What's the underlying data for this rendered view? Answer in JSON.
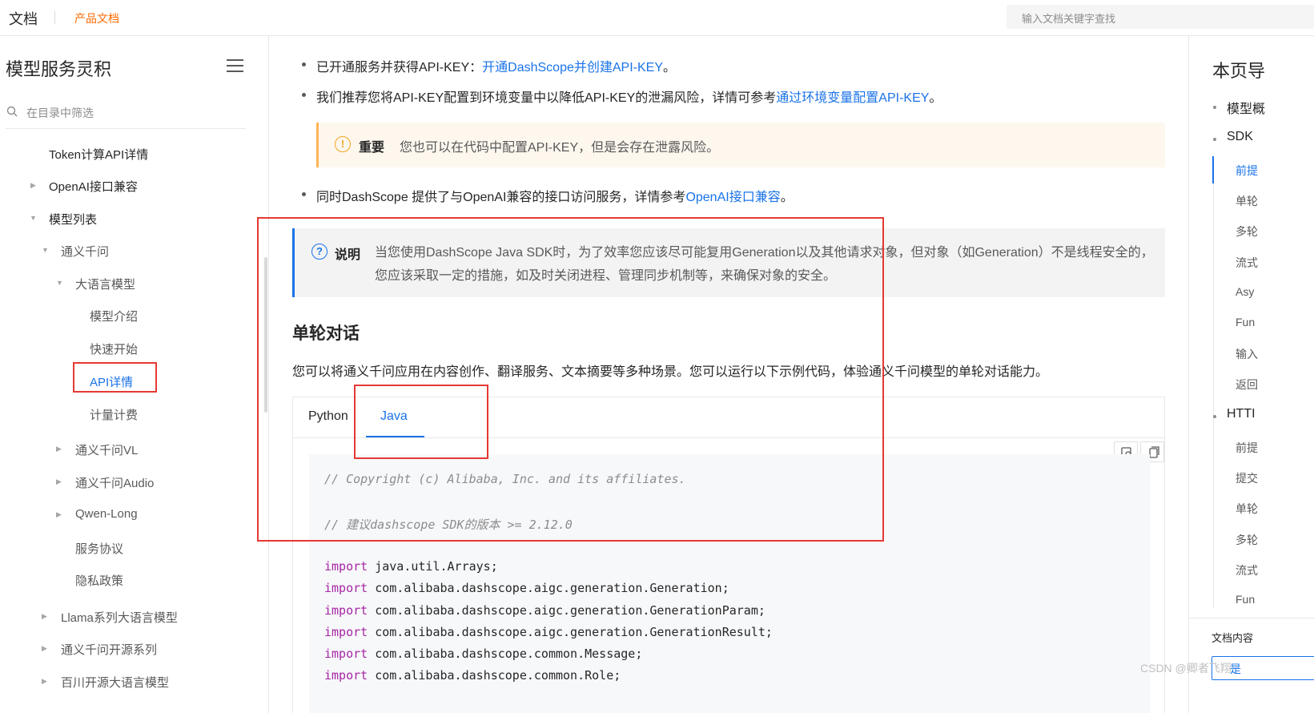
{
  "topbar": {
    "brand": "文档",
    "link": "产品文档",
    "search_placeholder": "输入文档关键字查找"
  },
  "sidebar": {
    "title": "模型服务灵积",
    "filter_placeholder": "在目录中筛选",
    "items": [
      {
        "label": "Token计算API详情"
      },
      {
        "label": "OpenAI接口兼容"
      },
      {
        "label": "模型列表"
      },
      {
        "label": "通义千问"
      },
      {
        "label": "大语言模型"
      },
      {
        "label": "模型介绍"
      },
      {
        "label": "快速开始"
      },
      {
        "label": "API详情"
      },
      {
        "label": "计量计费"
      },
      {
        "label": "通义千问VL"
      },
      {
        "label": "通义千问Audio"
      },
      {
        "label": "Qwen-Long"
      },
      {
        "label": "服务协议"
      },
      {
        "label": "隐私政策"
      },
      {
        "label": "Llama系列大语言模型"
      },
      {
        "label": "通义千问开源系列"
      },
      {
        "label": "百川开源大语言模型"
      }
    ]
  },
  "main": {
    "bullet1_text": "已开通服务并获得API-KEY：",
    "bullet1_link": "开通DashScope并创建API-KEY",
    "bullet1_end": "。",
    "bullet2_text": "我们推荐您将API-KEY配置到环境变量中以降低API-KEY的泄漏风险，详情可参考",
    "bullet2_link": "通过环境变量配置API-KEY",
    "bullet2_end": "。",
    "warning": {
      "icon": "!",
      "title": "重要",
      "text": "您也可以在代码中配置API-KEY，但是会存在泄露风险。"
    },
    "bullet3_text": "同时DashScope 提供了与OpenAI兼容的接口访问服务，详情参考",
    "bullet3_link": "OpenAI接口兼容",
    "bullet3_end": "。",
    "note": {
      "icon": "?",
      "title": "说明",
      "text": "当您使用DashScope Java SDK时，为了效率您应该尽可能复用Generation以及其他请求对象，但对象（如Generation）不是线程安全的，您应该采取一定的措施，如及时关闭进程、管理同步机制等，来确保对象的安全。"
    },
    "section_title": "单轮对话",
    "section_text": "您可以将通义千问应用在内容创作、翻译服务、文本摘要等多种场景。您可以运行以下示例代码，体验通义千问模型的单轮对话能力。",
    "tabs": [
      {
        "label": "Python"
      },
      {
        "label": "Java"
      }
    ],
    "code": {
      "comment1": "// Copyright (c) Alibaba, Inc. and its affiliates.",
      "comment2": "// 建议dashscope SDK的版本 >= 2.12.0",
      "keyword": "import",
      "imports": [
        "java.util.Arrays;",
        "com.alibaba.dashscope.aigc.generation.Generation;",
        "com.alibaba.dashscope.aigc.generation.GenerationParam;",
        "com.alibaba.dashscope.aigc.generation.GenerationResult;",
        "com.alibaba.dashscope.common.Message;",
        "com.alibaba.dashscope.common.Role;"
      ]
    }
  },
  "toc": {
    "title": "本页导",
    "items": [
      {
        "label": "模型概"
      },
      {
        "label": "SDK"
      },
      {
        "label": "前提"
      },
      {
        "label": "单轮"
      },
      {
        "label": "多轮"
      },
      {
        "label": "流式"
      },
      {
        "label": "Asy"
      },
      {
        "label": "Fun"
      },
      {
        "label": "输入"
      },
      {
        "label": "返回"
      },
      {
        "label": "HTTI"
      },
      {
        "label": "前提"
      },
      {
        "label": "提交"
      },
      {
        "label": "单轮"
      },
      {
        "label": "多轮"
      },
      {
        "label": "流式"
      },
      {
        "label": "Fun"
      }
    ],
    "footer_label": "文档内容",
    "footer_button": "是"
  },
  "watermark": "CSDN @卿者飞翔",
  "colors": {
    "accent": "#1a73e8",
    "brand_orange": "#ff6a00",
    "warning": "#f5a623",
    "annotation_red": "#e53935"
  }
}
